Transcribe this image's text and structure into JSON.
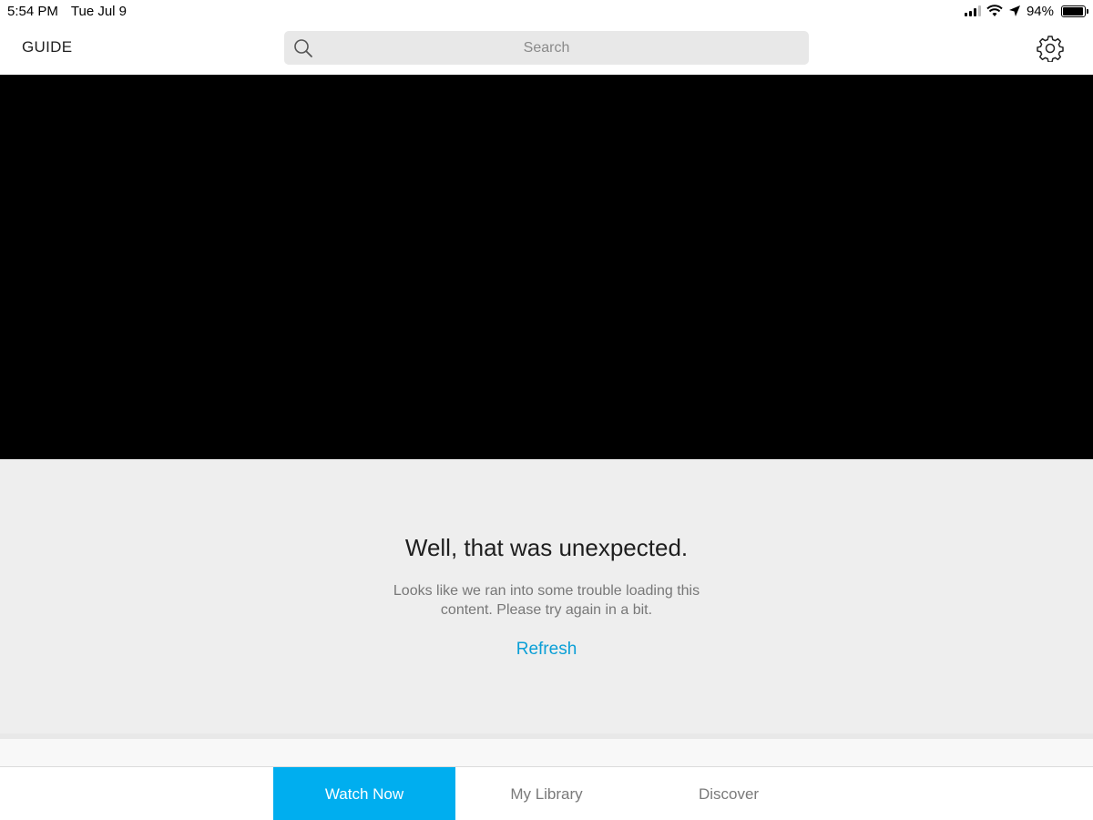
{
  "status_bar": {
    "time": "5:54 PM",
    "date": "Tue Jul 9",
    "battery_percent": "94%",
    "battery_level": 0.94
  },
  "header": {
    "guide_label": "GUIDE",
    "search_placeholder": "Search",
    "search_icon": "search-icon",
    "settings_icon": "gear-icon"
  },
  "error": {
    "title": "Well, that was unexpected.",
    "message": "Looks like we ran into some trouble loading this content. Please try again in a bit.",
    "refresh_label": "Refresh"
  },
  "tabs": [
    {
      "label": "Watch Now",
      "active": true
    },
    {
      "label": "My Library",
      "active": false
    },
    {
      "label": "Discover",
      "active": false
    }
  ],
  "colors": {
    "accent": "#00aeef",
    "link": "#0a9fd6",
    "panel_bg": "#eeeeee"
  }
}
